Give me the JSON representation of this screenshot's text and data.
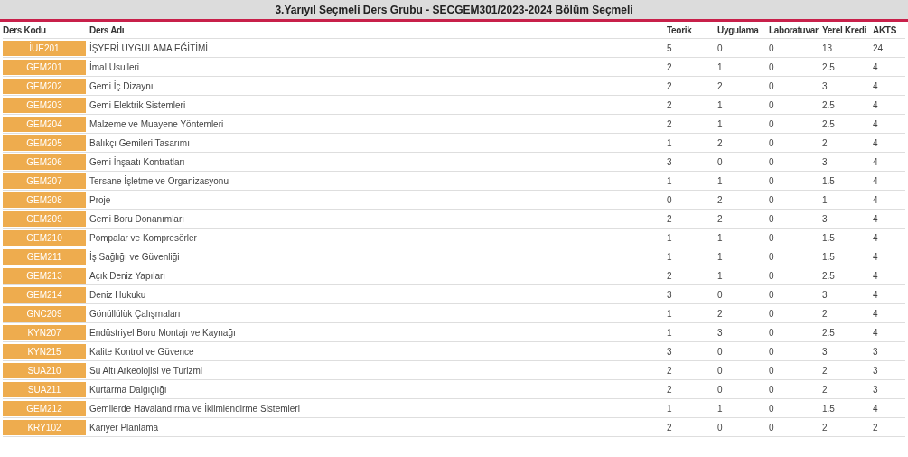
{
  "title": "3.Yarıyıl Seçmeli Ders Grubu - SECGEM301/2023-2024 Bölüm Seçmeli",
  "columns": [
    "Ders Kodu",
    "Ders Adı",
    "Teorik",
    "Uygulama",
    "Laboratuvar",
    "Yerel Kredi",
    "AKTS"
  ],
  "rows": [
    [
      "İUE201",
      "İŞYERİ UYGULAMA EĞİTİMİ",
      "5",
      "0",
      "0",
      "13",
      "24"
    ],
    [
      "GEM201",
      "İmal Usulleri",
      "2",
      "1",
      "0",
      "2.5",
      "4"
    ],
    [
      "GEM202",
      "Gemi İç Dizaynı",
      "2",
      "2",
      "0",
      "3",
      "4"
    ],
    [
      "GEM203",
      "Gemi Elektrik Sistemleri",
      "2",
      "1",
      "0",
      "2.5",
      "4"
    ],
    [
      "GEM204",
      "Malzeme ve Muayene Yöntemleri",
      "2",
      "1",
      "0",
      "2.5",
      "4"
    ],
    [
      "GEM205",
      "Balıkçı Gemileri Tasarımı",
      "1",
      "2",
      "0",
      "2",
      "4"
    ],
    [
      "GEM206",
      "Gemi İnşaatı Kontratları",
      "3",
      "0",
      "0",
      "3",
      "4"
    ],
    [
      "GEM207",
      "Tersane İşletme ve Organizasyonu",
      "1",
      "1",
      "0",
      "1.5",
      "4"
    ],
    [
      "GEM208",
      "Proje",
      "0",
      "2",
      "0",
      "1",
      "4"
    ],
    [
      "GEM209",
      "Gemi Boru Donanımları",
      "2",
      "2",
      "0",
      "3",
      "4"
    ],
    [
      "GEM210",
      "Pompalar ve Kompresörler",
      "1",
      "1",
      "0",
      "1.5",
      "4"
    ],
    [
      "GEM211",
      "İş Sağlığı ve Güvenliği",
      "1",
      "1",
      "0",
      "1.5",
      "4"
    ],
    [
      "GEM213",
      "Açık Deniz Yapıları",
      "2",
      "1",
      "0",
      "2.5",
      "4"
    ],
    [
      "GEM214",
      "Deniz Hukuku",
      "3",
      "0",
      "0",
      "3",
      "4"
    ],
    [
      "GNC209",
      "Gönüllülük Çalışmaları",
      "1",
      "2",
      "0",
      "2",
      "4"
    ],
    [
      "KYN207",
      "Endüstriyel Boru Montajı ve Kaynağı",
      "1",
      "3",
      "0",
      "2.5",
      "4"
    ],
    [
      "KYN215",
      "Kalite Kontrol ve Güvence",
      "3",
      "0",
      "0",
      "3",
      "3"
    ],
    [
      "SUA210",
      "Su Altı Arkeolojisi ve Turizmi",
      "2",
      "0",
      "0",
      "2",
      "3"
    ],
    [
      "SUA211",
      "Kurtarma Dalgıçlığı",
      "2",
      "0",
      "0",
      "2",
      "3"
    ],
    [
      "GEM212",
      "Gemilerde Havalandırma ve İklimlendirme Sistemleri",
      "1",
      "1",
      "0",
      "1.5",
      "4"
    ],
    [
      "KRY102",
      "Kariyer Planlama",
      "2",
      "0",
      "0",
      "2",
      "2"
    ]
  ]
}
